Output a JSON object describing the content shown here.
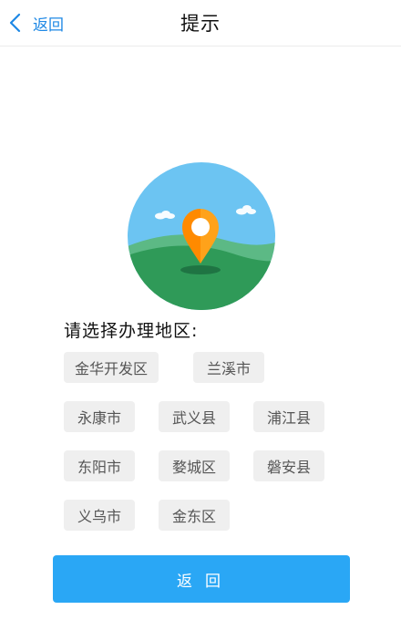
{
  "navbar": {
    "back_label": "返回",
    "title": "提示"
  },
  "prompt": "请选择办理地区:",
  "regions": [
    [
      "金华开发区",
      "兰溪市"
    ],
    [
      "永康市",
      "武义县",
      "浦江县"
    ],
    [
      "东阳市",
      "婺城区",
      "磐安县"
    ],
    [
      "义乌市",
      "金东区"
    ]
  ],
  "footer": {
    "button_label": "返回"
  },
  "colors": {
    "accent": "#2aa7f5",
    "link": "#1e88e5",
    "chip_bg": "#efefef"
  },
  "icons": {
    "back": "chevron-left-icon",
    "illustration": "map-location-pin-illustration"
  }
}
